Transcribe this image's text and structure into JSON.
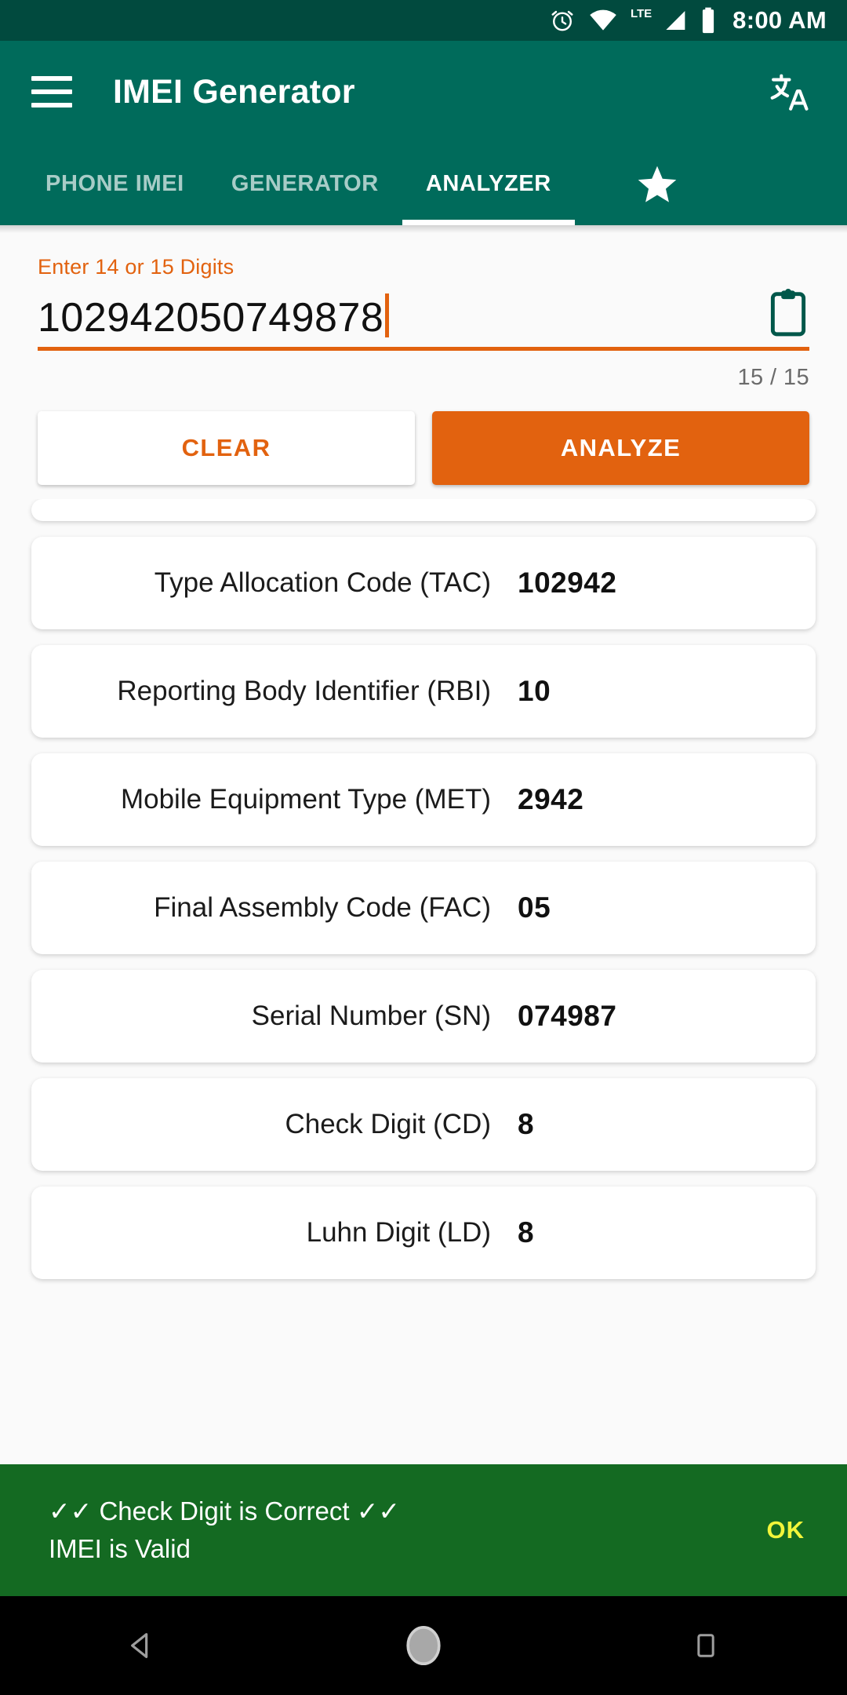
{
  "status_bar": {
    "time": "8:00 AM",
    "lte_label": "LTE",
    "icons": [
      "alarm-icon",
      "wifi-icon",
      "lte-signal-icon",
      "battery-icon"
    ]
  },
  "app_bar": {
    "title": "IMEI Generator",
    "menu_icon": "hamburger-menu-icon",
    "action_icon": "translate-icon"
  },
  "tabs": [
    {
      "label": "PHONE IMEI",
      "active": false
    },
    {
      "label": "GENERATOR",
      "active": false
    },
    {
      "label": "ANALYZER",
      "active": true
    }
  ],
  "tab_star_icon": "star-icon",
  "input": {
    "label": "Enter 14 or 15 Digits",
    "value": "102942050749878",
    "placeholder": "Enter 14 or 15 Digits",
    "counter": "15 / 15",
    "paste_icon": "clipboard-paste-icon"
  },
  "buttons": {
    "clear": "CLEAR",
    "analyze": "ANALYZE"
  },
  "results": [
    {
      "label": "Type Allocation Code (TAC)",
      "value": "102942"
    },
    {
      "label": "Reporting Body Identifier (RBI)",
      "value": "10"
    },
    {
      "label": "Mobile Equipment Type (MET)",
      "value": "2942"
    },
    {
      "label": "Final Assembly Code (FAC)",
      "value": "05"
    },
    {
      "label": "Serial Number (SN)",
      "value": "074987"
    },
    {
      "label": "Check Digit (CD)",
      "value": "8"
    },
    {
      "label": "Luhn Digit (LD)",
      "value": "8"
    }
  ],
  "snackbar": {
    "message": "✓✓ Check Digit is Correct ✓✓\nIMEI is Valid",
    "action": "OK"
  },
  "nav_bar": {
    "back": "back-triangle-icon",
    "home": "home-circle-icon",
    "recents": "recents-square-icon"
  },
  "colors": {
    "status_bar": "#014a3e",
    "app_bar": "#006b5b",
    "accent_orange": "#e2620f",
    "snackbar_green": "#146a22",
    "snackbar_action": "#f2f53a",
    "page_bg": "#fafafa"
  }
}
